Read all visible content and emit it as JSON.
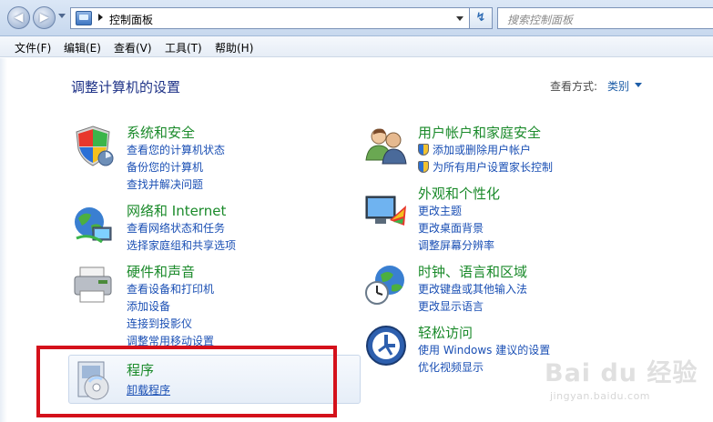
{
  "address_bar": {
    "path": "控制面板",
    "search_placeholder": "搜索控制面板",
    "back": "◀",
    "forward": "▶",
    "refresh": "↯"
  },
  "menu": [
    "文件(F)",
    "编辑(E)",
    "查看(V)",
    "工具(T)",
    "帮助(H)"
  ],
  "page_title": "调整计算机的设置",
  "view_by": {
    "label": "查看方式:",
    "value": "类别"
  },
  "categories": [
    {
      "title": "系统和安全",
      "links": [
        "查看您的计算机状态",
        "备份您的计算机",
        "查找并解决问题"
      ]
    },
    {
      "title": "网络和 Internet",
      "links": [
        "查看网络状态和任务",
        "选择家庭组和共享选项"
      ]
    },
    {
      "title": "硬件和声音",
      "links": [
        "查看设备和打印机",
        "添加设备",
        "连接到投影仪",
        "调整常用移动设置"
      ]
    },
    {
      "title": "程序",
      "links": [
        "卸载程序"
      ]
    },
    {
      "title": "用户帐户和家庭安全",
      "links": [
        "添加或删除用户帐户",
        "为所有用户设置家长控制"
      ]
    },
    {
      "title": "外观和个性化",
      "links": [
        "更改主题",
        "更改桌面背景",
        "调整屏幕分辨率"
      ]
    },
    {
      "title": "时钟、语言和区域",
      "links": [
        "更改键盘或其他输入法",
        "更改显示语言"
      ]
    },
    {
      "title": "轻松访问",
      "links": [
        "使用 Windows 建议的设置",
        "优化视频显示"
      ]
    }
  ],
  "watermark": {
    "brand": "Bai du 经验",
    "url": "jingyan.baidu.com"
  },
  "colors": {
    "category_title": "#1a8a2a",
    "link": "#1a4fb4",
    "highlight": "#d4111b"
  }
}
